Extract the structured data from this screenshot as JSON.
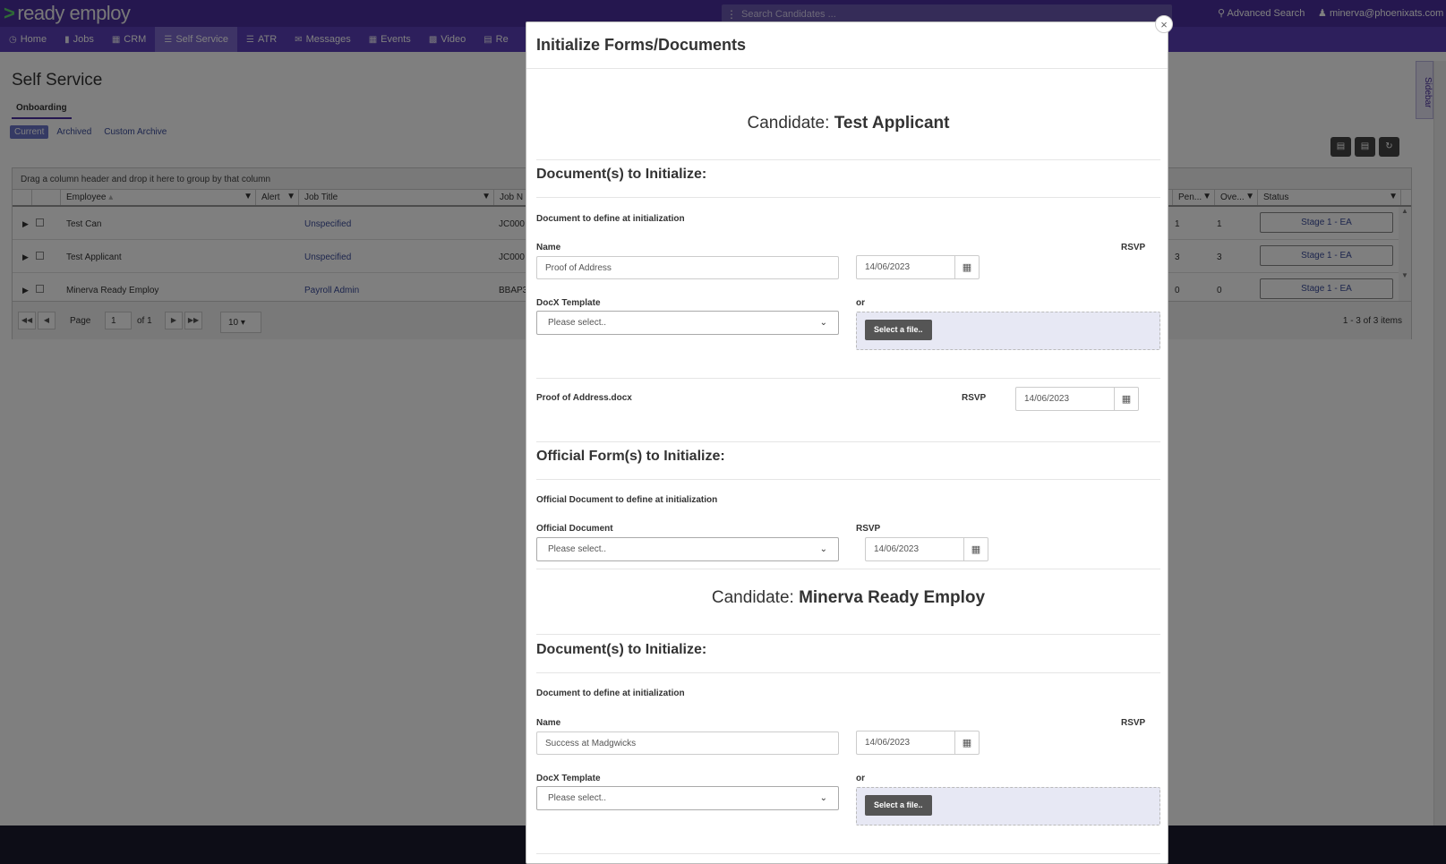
{
  "app": {
    "logo_text": "ready employ",
    "search_placeholder": "Search Candidates ...",
    "advanced_search": "Advanced Search",
    "user_email": "minerva@phoenixats.com"
  },
  "nav": {
    "items": [
      {
        "label": "Home"
      },
      {
        "label": "Jobs"
      },
      {
        "label": "CRM"
      },
      {
        "label": "Self Service"
      },
      {
        "label": "ATR"
      },
      {
        "label": "Messages"
      },
      {
        "label": "Events"
      },
      {
        "label": "Video"
      },
      {
        "label": "Re"
      }
    ]
  },
  "page": {
    "title": "Self Service",
    "tab": "Onboarding",
    "filters": [
      "Current",
      "Archived",
      "Custom Archive"
    ],
    "sidebar_label": "Sidebar"
  },
  "grid": {
    "group_hint": "Drag a column header and drop it here to group by that column",
    "columns": {
      "employee": "Employee",
      "alert": "Alert",
      "job_title": "Job Title",
      "job_no": "Job N",
      "pen": "Pen...",
      "ove": "Ove...",
      "status": "Status"
    },
    "rows": [
      {
        "employee": "Test Can",
        "job_title": "Unspecified",
        "job_no": "JC000",
        "pen": "1",
        "ove": "1",
        "status": "Stage 1 - EA"
      },
      {
        "employee": "Test Applicant",
        "job_title": "Unspecified",
        "job_no": "JC000",
        "pen": "3",
        "ove": "3",
        "status": "Stage 1 - EA"
      },
      {
        "employee": "Minerva Ready Employ",
        "job_title": "Payroll Admin",
        "job_no": "BBAP3",
        "pen": "0",
        "ove": "0",
        "status": "Stage 1 - EA"
      }
    ],
    "pager": {
      "page_label": "Page",
      "page_value": "1",
      "of_label": "of 1",
      "page_size": "10",
      "info": "1 - 3 of 3 items"
    }
  },
  "modal": {
    "title": "Initialize Forms/Documents",
    "candidate_label": "Candidate:",
    "docs_heading": "Document(s) to Initialize:",
    "define_label": "Document to define at initialization",
    "name_label": "Name",
    "rsvp_label": "RSVP",
    "docx_label": "DocX Template",
    "or_label": "or",
    "select_placeholder": "Please select..",
    "file_button": "Select a file..",
    "official_heading": "Official Form(s) to Initialize:",
    "official_define_label": "Official Document to define at initialization",
    "official_doc_label": "Official Document",
    "candidates": [
      {
        "name": "Test Applicant",
        "doc_name": "Proof of Address",
        "rsvp": "14/06/2023",
        "attached_file": "Proof of Address.docx",
        "attached_rsvp": "14/06/2023",
        "official_rsvp": "14/06/2023"
      },
      {
        "name": "Minerva Ready Employ",
        "doc_name": "Success at Madgwicks",
        "rsvp": "14/06/2023"
      }
    ]
  },
  "icons": {
    "close": "close-icon",
    "calendar": "calendar-icon",
    "filter": "filter-icon"
  }
}
